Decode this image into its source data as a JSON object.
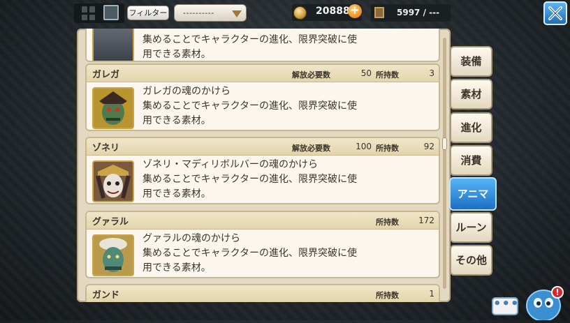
{
  "topbar": {
    "filter_label": "フィルター",
    "dropdown_value": "----------",
    "coins": "20888",
    "capacity": "5997 / ---"
  },
  "labels": {
    "required": "解放必要数",
    "owned": "所持数"
  },
  "items": [
    {
      "name": "",
      "desc": "集めることでキャラクターの進化、限界突破に使\n用できる素材。",
      "required": null,
      "owned": null
    },
    {
      "name": "ガレガ",
      "desc": "ガレガの魂のかけら\n集めることでキャラクターの進化、限界突破に使\n用できる素材。",
      "required": "50",
      "owned": "3"
    },
    {
      "name": "ゾネリ",
      "desc": "ゾネリ・マディリボルバーの魂のかけら\n集めることでキャラクターの進化、限界突破に使\n用できる素材。",
      "required": "100",
      "owned": "92"
    },
    {
      "name": "グァラル",
      "desc": "グァラルの魂のかけら\n集めることでキャラクターの進化、限界突破に使\n用できる素材。",
      "required": null,
      "owned": "172"
    },
    {
      "name": "ガンド",
      "desc": "",
      "required": null,
      "owned": "1"
    }
  ],
  "tabs": [
    {
      "label": "装備",
      "active": false
    },
    {
      "label": "素材",
      "active": false
    },
    {
      "label": "進化",
      "active": false
    },
    {
      "label": "消費",
      "active": false
    },
    {
      "label": "アニマ",
      "active": true
    },
    {
      "label": "ルーン",
      "active": false
    },
    {
      "label": "その他",
      "active": false
    }
  ],
  "chat": {
    "label": "•••"
  },
  "notification": {
    "badge": "!"
  },
  "colors": {
    "accent": "#1d6fc4",
    "panel": "#e3d9c3",
    "header": "#e3d4ac"
  }
}
